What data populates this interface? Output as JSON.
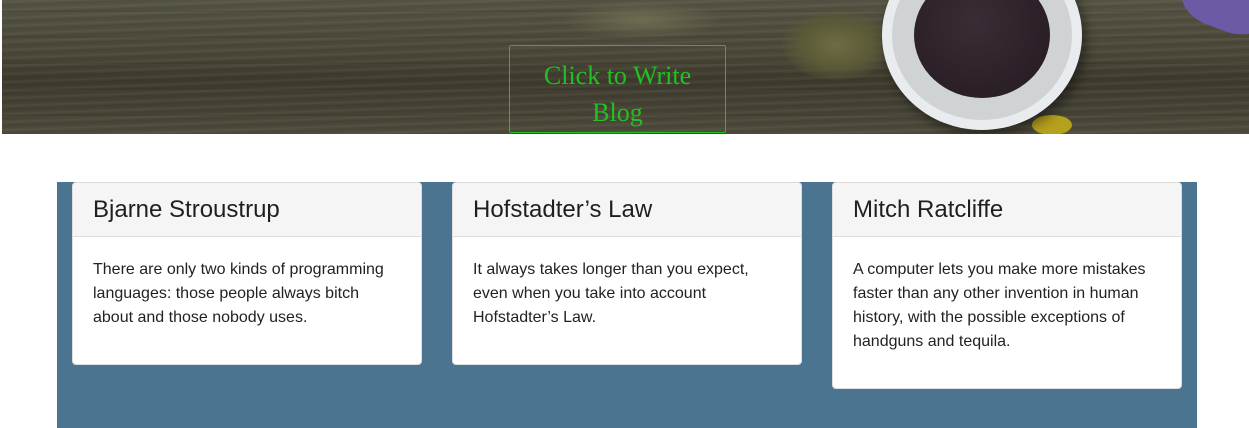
{
  "hero": {
    "write_button_label": "Click to Write Blog"
  },
  "cards": [
    {
      "title": "Bjarne Stroustrup",
      "quote": "There are only two kinds of programming languages: those people always bitch about and those nobody uses."
    },
    {
      "title": "Hofstadter’s Law",
      "quote": "It always takes longer than you expect, even when you take into account Hofstadter’s Law."
    },
    {
      "title": "Mitch Ratcliffe",
      "quote": "A computer lets you make more mistakes faster than any other invention in human history, with the possible exceptions of handguns and tequila."
    }
  ],
  "colors": {
    "accent_green": "#22c022",
    "band_blue": "#4a748f",
    "card_header_bg": "#f5f5f5"
  }
}
